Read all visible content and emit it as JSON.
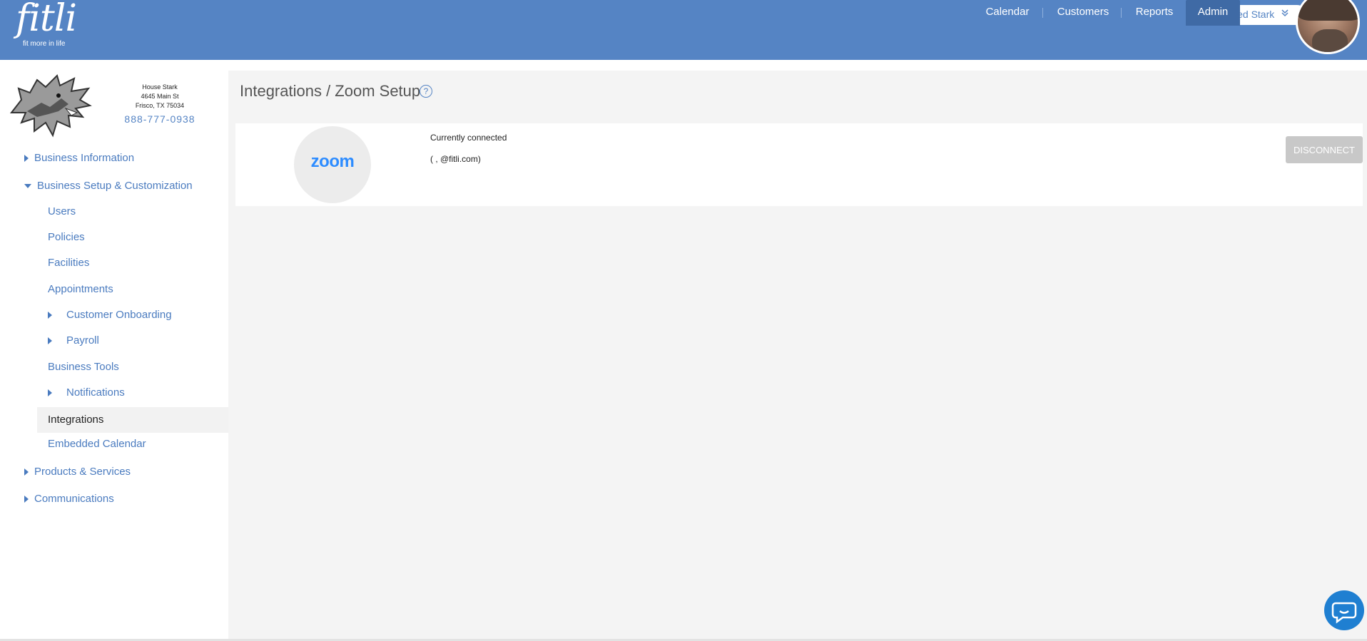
{
  "header": {
    "logo_word": "fitli",
    "logo_tagline": "fit more in life",
    "user_name": "Ned Stark",
    "nav": [
      {
        "label": "Calendar"
      },
      {
        "label": "Customers"
      },
      {
        "label": "Reports"
      },
      {
        "label": "Admin",
        "active": true
      }
    ]
  },
  "business": {
    "name": "House Stark",
    "street": "4645 Main St",
    "city": "Frisco, TX 75034",
    "phone": "888-777-0938"
  },
  "sidebar": {
    "items": [
      {
        "label": "Business Information"
      },
      {
        "label": "Business Setup & Customization"
      },
      {
        "label": "Users"
      },
      {
        "label": "Policies"
      },
      {
        "label": "Facilities"
      },
      {
        "label": "Appointments"
      },
      {
        "label": "Customer Onboarding"
      },
      {
        "label": "Payroll"
      },
      {
        "label": "Business Tools"
      },
      {
        "label": "Notifications"
      },
      {
        "label": "Integrations",
        "selected": true
      },
      {
        "label": "Embedded Calendar"
      },
      {
        "label": "Products & Services"
      },
      {
        "label": "Communications"
      }
    ]
  },
  "main": {
    "title": "Integrations / Zoom Setup",
    "help_glyph": "?",
    "integration": {
      "logo_text": "zoom",
      "status": "Currently connected",
      "account": "(            ,    @fitli.com)",
      "disconnect_label": "DISCONNECT"
    }
  },
  "colors": {
    "header": "#5584c4",
    "nav_active": "#3f6aa5",
    "link": "#4a7bbf",
    "zoom_blue": "#2d8cff",
    "main_bg": "#f4f4f4",
    "button_disabled": "#c8c8c8",
    "chat": "#1f7fd1"
  },
  "icons": {
    "help": "question-circle-icon",
    "chevron": "chevron-double-down-icon",
    "chat": "chat-bubble-icon"
  }
}
